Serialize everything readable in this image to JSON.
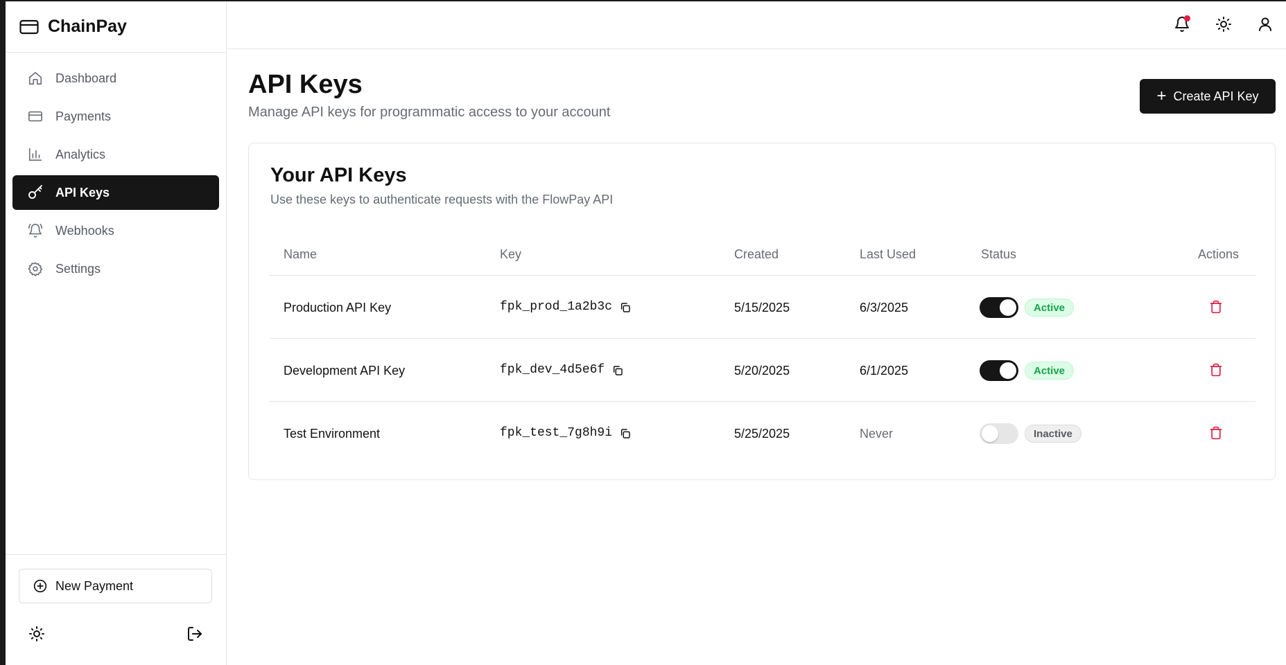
{
  "app": {
    "name": "ChainPay"
  },
  "sidebar": {
    "items": [
      {
        "label": "Dashboard",
        "icon": "home-icon",
        "active": false
      },
      {
        "label": "Payments",
        "icon": "credit-card-icon",
        "active": false
      },
      {
        "label": "Analytics",
        "icon": "bar-chart-icon",
        "active": false
      },
      {
        "label": "API Keys",
        "icon": "key-icon",
        "active": true
      },
      {
        "label": "Webhooks",
        "icon": "bell-ring-icon",
        "active": false
      },
      {
        "label": "Settings",
        "icon": "gear-icon",
        "active": false
      }
    ],
    "new_payment_label": "New Payment"
  },
  "header": {
    "notification_unread": true
  },
  "page": {
    "title": "API Keys",
    "subtitle": "Manage API keys for programmatic access to your account",
    "create_button_label": "Create API Key"
  },
  "card": {
    "title": "Your API Keys",
    "subtitle": "Use these keys to authenticate requests with the FlowPay API"
  },
  "table": {
    "columns": [
      "Name",
      "Key",
      "Created",
      "Last Used",
      "Status",
      "Actions"
    ],
    "rows": [
      {
        "name": "Production API Key",
        "key": "fpk_prod_1a2b3c",
        "created": "5/15/2025",
        "last_used": "6/3/2025",
        "enabled": true,
        "status": "Active"
      },
      {
        "name": "Development API Key",
        "key": "fpk_dev_4d5e6f",
        "created": "5/20/2025",
        "last_used": "6/1/2025",
        "enabled": true,
        "status": "Active"
      },
      {
        "name": "Test Environment",
        "key": "fpk_test_7g8h9i",
        "created": "5/25/2025",
        "last_used": "Never",
        "enabled": false,
        "status": "Inactive"
      }
    ]
  },
  "colors": {
    "primary": "#161616",
    "active_badge_bg": "#dcfce7",
    "active_badge_text": "#16a34a",
    "danger": "#e11d48",
    "muted_text": "#666b73"
  }
}
